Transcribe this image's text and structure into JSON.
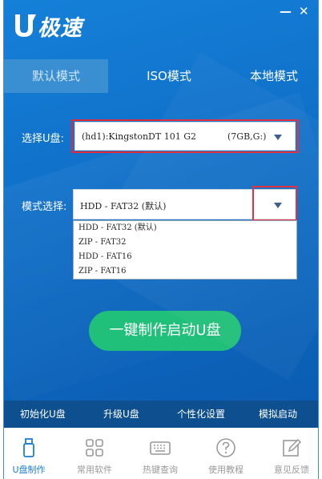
{
  "app": {
    "logo_text": "极速",
    "minimize_label": "—",
    "close_label": "✕"
  },
  "tabs": [
    {
      "label": "默认模式",
      "active": true
    },
    {
      "label": "ISO模式",
      "active": false
    },
    {
      "label": "本地模式",
      "active": false
    }
  ],
  "form": {
    "usb_label": "选择U盘:",
    "usb_value": "(hd1):KingstonDT 101 G2",
    "usb_size": "(7GB,G:)",
    "mode_label": "模式选择:",
    "mode_value": "HDD - FAT32 (默认)",
    "mode_options": [
      "HDD - FAT32 (默认)",
      "ZIP - FAT32",
      "HDD - FAT16",
      "ZIP - FAT16"
    ]
  },
  "start_button": "一键制作启动U盘",
  "footer_links": [
    "初始化U盘",
    "升级U盘",
    "个性化设置",
    "模拟启动"
  ],
  "bottom_nav": [
    {
      "label": "U盘制作",
      "icon": "usb-drive-icon",
      "active": true
    },
    {
      "label": "常用软件",
      "icon": "apps-grid-icon",
      "active": false
    },
    {
      "label": "热键查询",
      "icon": "keyboard-icon",
      "active": false
    },
    {
      "label": "使用教程",
      "icon": "help-icon",
      "active": false
    },
    {
      "label": "意见反馈",
      "icon": "feedback-edit-icon",
      "active": false
    }
  ],
  "colors": {
    "accent": "#1a7fd6",
    "start_button": "#21c07a",
    "highlight_box": "#e32a3b"
  }
}
